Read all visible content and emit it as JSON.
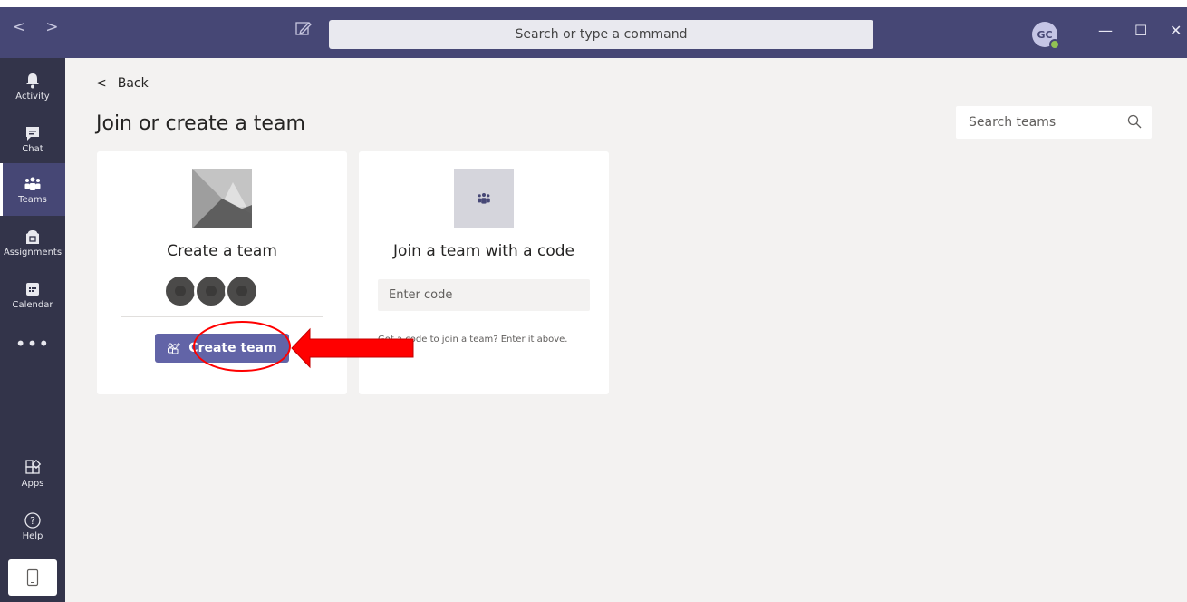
{
  "titlebar": {
    "search_placeholder": "Search or type a command",
    "avatar_initials": "GC",
    "minimize": "—",
    "maximize": "☐",
    "close": "✕"
  },
  "rail": {
    "items": [
      {
        "label": "Activity",
        "icon": "bell-icon"
      },
      {
        "label": "Chat",
        "icon": "chat-icon"
      },
      {
        "label": "Teams",
        "icon": "teams-icon",
        "active": true
      },
      {
        "label": "Assignments",
        "icon": "assignments-icon"
      },
      {
        "label": "Calendar",
        "icon": "calendar-icon"
      }
    ],
    "more": "•••",
    "apps_label": "Apps",
    "help_label": "Help"
  },
  "main": {
    "back_label": "Back",
    "page_title": "Join or create a team",
    "search_teams_placeholder": "Search teams",
    "create_card": {
      "title": "Create a team",
      "button_label": "Create team"
    },
    "join_card": {
      "title": "Join a team with a code",
      "input_placeholder": "Enter code",
      "hint": "Got a code to join a team? Enter it above."
    }
  },
  "colors": {
    "titlebar": "#464775",
    "rail": "#33344a",
    "accent": "#6264a7",
    "annotation": "#ff0000"
  }
}
